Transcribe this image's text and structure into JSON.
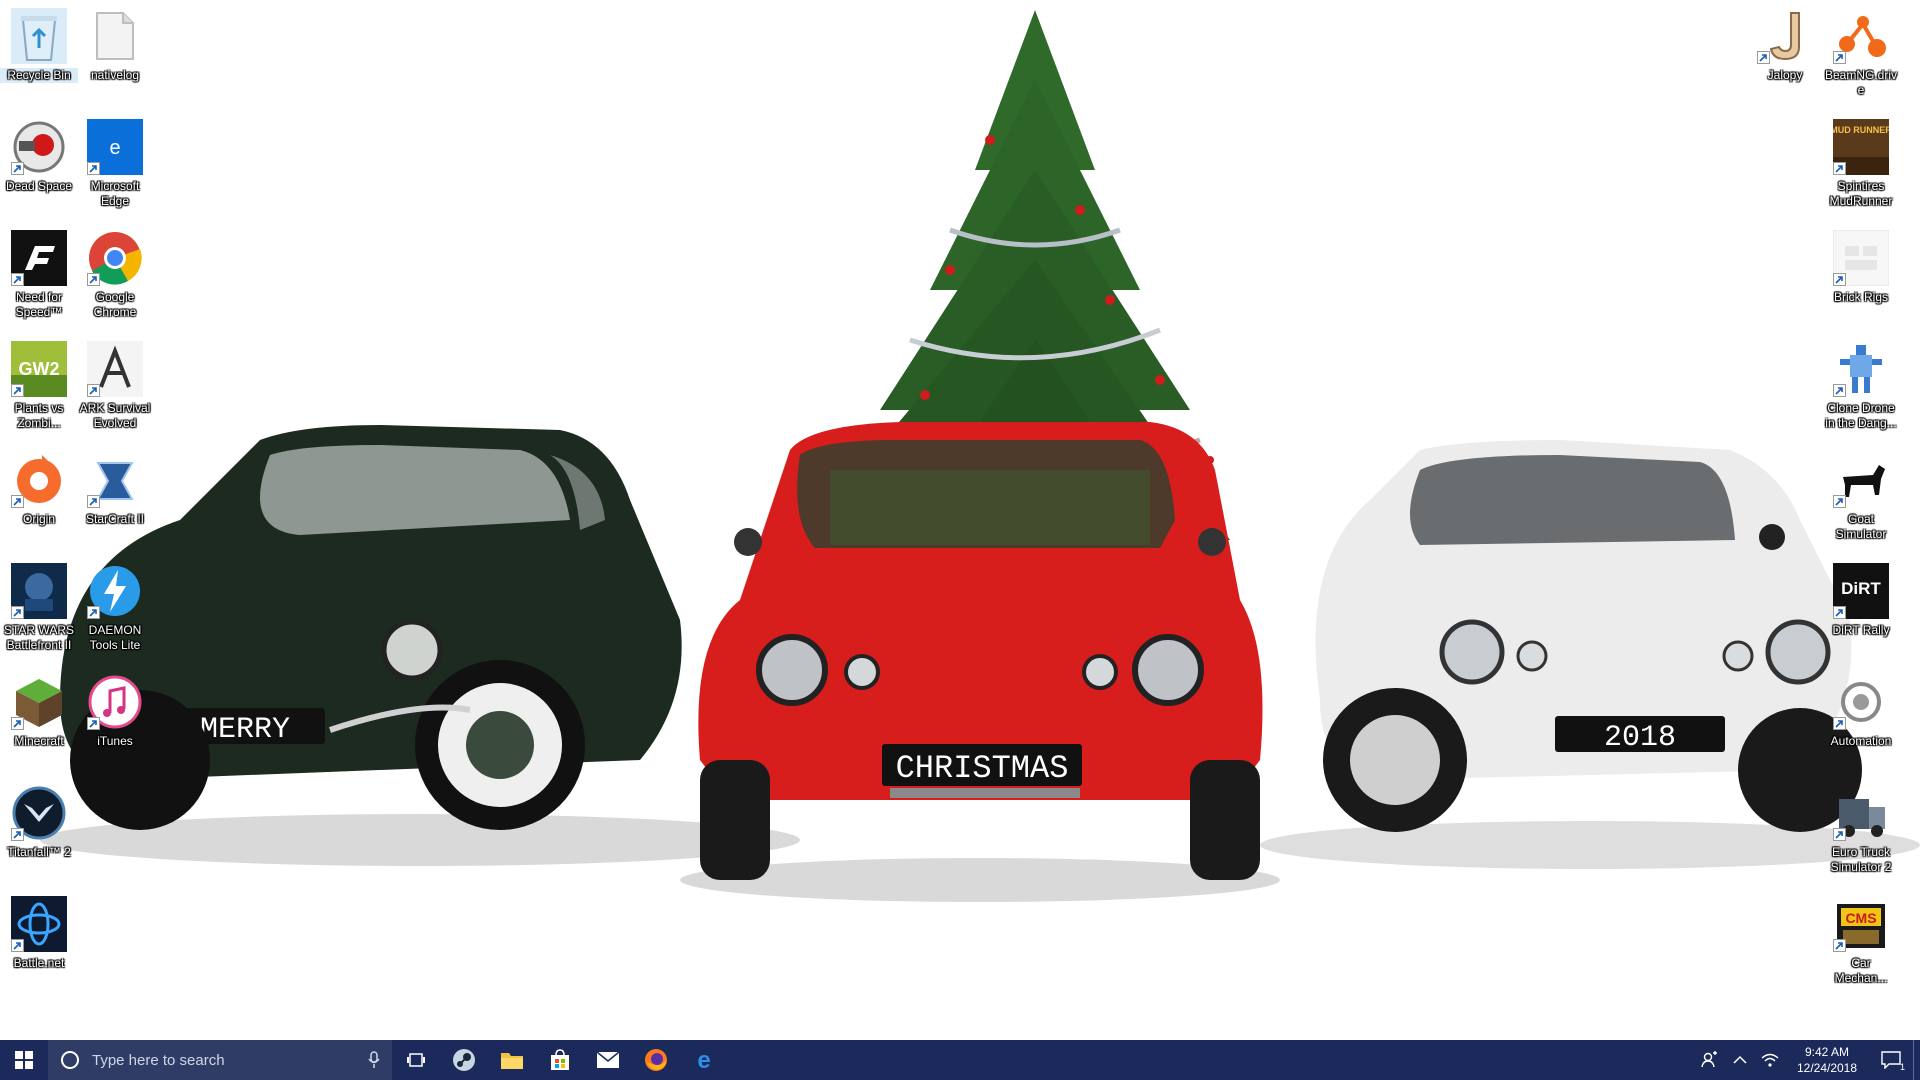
{
  "wallpaper": {
    "plates": {
      "left": "MERRY",
      "center": "CHRISTMAS",
      "right": "2018"
    },
    "colors": {
      "left_car": "#1c2a1f",
      "center_car": "#d81d1d",
      "right_car": "#ececec",
      "tree": "#2f6a2a"
    }
  },
  "desktop": {
    "icons_left": [
      {
        "label": "Recycle Bin",
        "icon": "recycle-bin-icon"
      },
      {
        "label": "nativelog",
        "icon": "text-file-icon"
      },
      {
        "label": "Dead Space",
        "icon": "dead-space-icon"
      },
      {
        "label": "Microsoft Edge",
        "icon": "edge-icon"
      },
      {
        "label": "Need for Speed™",
        "icon": "need-for-speed-icon"
      },
      {
        "label": "Google Chrome",
        "icon": "chrome-icon"
      },
      {
        "label": "Plants vs Zombi...",
        "icon": "plants-vs-zombies-icon"
      },
      {
        "label": "ARK Survival Evolved",
        "icon": "ark-icon"
      },
      {
        "label": "Origin",
        "icon": "origin-icon"
      },
      {
        "label": "StarCraft II",
        "icon": "starcraft-icon"
      },
      {
        "label": "STAR WARS Battlefront II",
        "icon": "star-wars-icon"
      },
      {
        "label": "DAEMON Tools Lite",
        "icon": "daemon-tools-icon"
      },
      {
        "label": "Minecraft",
        "icon": "minecraft-icon"
      },
      {
        "label": "iTunes",
        "icon": "itunes-icon"
      },
      {
        "label": "Titanfall™ 2",
        "icon": "titanfall-icon"
      },
      {
        "label": "Battle.net",
        "icon": "battlenet-icon"
      }
    ],
    "icons_right": [
      {
        "label": "Jalopy",
        "icon": "jalopy-icon"
      },
      {
        "label": "BeamNG.drive",
        "icon": "beamng-icon"
      },
      {
        "label": "Spintires MudRunner",
        "icon": "mudrunner-icon"
      },
      {
        "label": "Brick Rigs",
        "icon": "brick-rigs-icon"
      },
      {
        "label": "Clone Drone in the Dang...",
        "icon": "clone-drone-icon"
      },
      {
        "label": "Goat Simulator",
        "icon": "goat-icon"
      },
      {
        "label": "DiRT Rally",
        "icon": "dirt-rally-icon"
      },
      {
        "label": "Automation",
        "icon": "automation-icon"
      },
      {
        "label": "Euro Truck Simulator 2",
        "icon": "euro-truck-icon"
      },
      {
        "label": "Car Mechan...",
        "icon": "car-mechanic-icon"
      }
    ],
    "icon_badges": {
      "dirt": "DiRT",
      "cms": "CMS",
      "mudrunner": "MUD RUNNER"
    }
  },
  "taskbar": {
    "search_placeholder": "Type here to search",
    "apps": [
      "task-view-icon",
      "steam-icon",
      "file-explorer-icon",
      "store-icon",
      "mail-icon",
      "firefox-icon",
      "edge-icon"
    ],
    "clock_time": "9:42 AM",
    "clock_date": "12/24/2018",
    "notification_count": "1",
    "colors": {
      "bar": "#1b2a5a",
      "search": "#2f3c66"
    }
  }
}
